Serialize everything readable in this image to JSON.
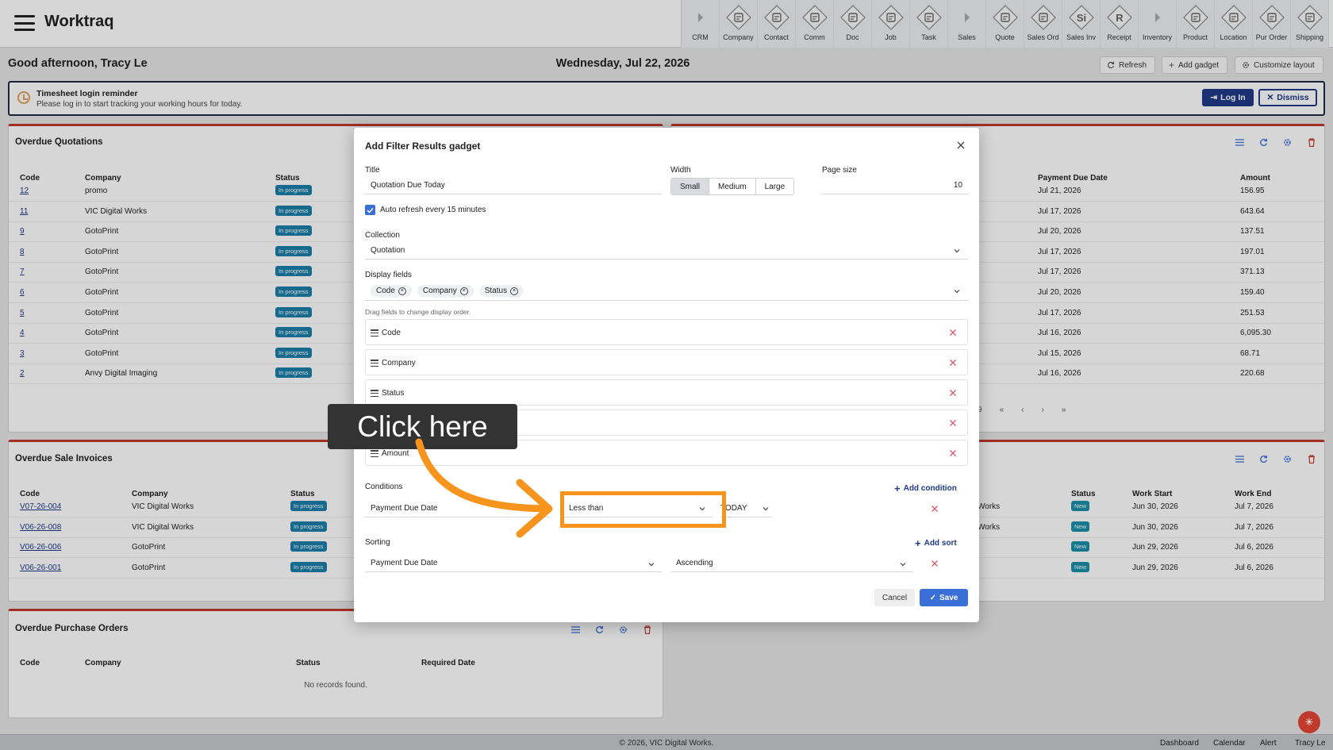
{
  "app": {
    "title": "Worktraq"
  },
  "modules": [
    {
      "label": "CRM",
      "icon": "chevron-right-icon",
      "sep": true
    },
    {
      "label": "Company",
      "icon": "company-icon"
    },
    {
      "label": "Contact",
      "icon": "contact-icon"
    },
    {
      "label": "Comm",
      "icon": "comm-icon"
    },
    {
      "label": "Doc",
      "icon": "doc-icon"
    },
    {
      "label": "Job",
      "icon": "job-icon"
    },
    {
      "label": "Task",
      "icon": "task-icon"
    },
    {
      "label": "Sales",
      "icon": "chevron-right-icon",
      "sep": true
    },
    {
      "label": "Quote",
      "icon": "quote-icon"
    },
    {
      "label": "Sales Ord",
      "icon": "sales-order-icon"
    },
    {
      "label": "Sales Inv",
      "icon": "sales-invoice-icon",
      "glyph": "Si"
    },
    {
      "label": "Receipt",
      "icon": "receipt-icon",
      "glyph": "R"
    },
    {
      "label": "Inventory",
      "icon": "chevron-right-icon",
      "sep": true
    },
    {
      "label": "Product",
      "icon": "product-icon"
    },
    {
      "label": "Location",
      "icon": "location-icon"
    },
    {
      "label": "Pur Order",
      "icon": "purchase-order-icon"
    },
    {
      "label": "Shipping",
      "icon": "shipping-icon"
    }
  ],
  "dashboard": {
    "greeting": "Good afternoon, Tracy Le",
    "date": "Wednesday, Jul 22, 2026",
    "refresh": "Refresh",
    "add_gadget": "Add gadget",
    "customize": "Customize layout"
  },
  "reminder": {
    "title": "Timesheet login reminder",
    "text": "Please log in to start tracking your working hours for today.",
    "login": "Log In",
    "dismiss": "Dismiss"
  },
  "quotations": {
    "title": "Overdue Quotations",
    "headers": [
      "Code",
      "Company",
      "Status"
    ],
    "rows": [
      {
        "code": "12",
        "company": "promo",
        "status": "In progress"
      },
      {
        "code": "11",
        "company": "VIC Digital Works",
        "status": "In progress"
      },
      {
        "code": "9",
        "company": "GotoPrint",
        "status": "In progress"
      },
      {
        "code": "8",
        "company": "GotoPrint",
        "status": "In progress"
      },
      {
        "code": "7",
        "company": "GotoPrint",
        "status": "In progress"
      },
      {
        "code": "6",
        "company": "GotoPrint",
        "status": "In progress"
      },
      {
        "code": "5",
        "company": "GotoPrint",
        "status": "In progress"
      },
      {
        "code": "4",
        "company": "GotoPrint",
        "status": "In progress"
      },
      {
        "code": "3",
        "company": "GotoPrint",
        "status": "In progress"
      },
      {
        "code": "2",
        "company": "Anvy Digital Imaging",
        "status": "In progress"
      }
    ]
  },
  "right_top": {
    "headers": [
      "Payment Due Date",
      "Amount"
    ],
    "rows": [
      {
        "date": "Jul 21, 2026",
        "amount": "156.95"
      },
      {
        "date": "Jul 17, 2026",
        "amount": "643.64"
      },
      {
        "date": "Jul 20, 2026",
        "amount": "137.51"
      },
      {
        "date": "Jul 17, 2026",
        "amount": "197.01"
      },
      {
        "date": "Jul 17, 2026",
        "amount": "371.13"
      },
      {
        "date": "Jul 20, 2026",
        "amount": "159.40"
      },
      {
        "date": "Jul 17, 2026",
        "amount": "251.53"
      },
      {
        "date": "Jul 16, 2026",
        "amount": "6,095.30"
      },
      {
        "date": "Jul 15, 2026",
        "amount": "68.71"
      },
      {
        "date": "Jul 16, 2026",
        "amount": "220.68"
      }
    ],
    "pager": [
      "9",
      "«",
      "‹",
      "›",
      "»"
    ]
  },
  "invoices": {
    "title": "Overdue Sale Invoices",
    "headers": [
      "Code",
      "Company",
      "Status"
    ],
    "rows": [
      {
        "code": "V07-26-004",
        "company": "VIC Digital Works",
        "status": "In progress"
      },
      {
        "code": "V06-26-008",
        "company": "VIC Digital Works",
        "status": "In progress"
      },
      {
        "code": "V06-26-006",
        "company": "GotoPrint",
        "status": "In progress"
      },
      {
        "code": "V06-26-001",
        "company": "GotoPrint",
        "status": "In progress"
      }
    ]
  },
  "right_mid": {
    "headers": [
      "Status",
      "Work Start",
      "Work End"
    ],
    "rows": [
      {
        "frag": "Works",
        "status": "New",
        "start": "Jun 30, 2026",
        "end": "Jul 7, 2026"
      },
      {
        "frag": "Works",
        "status": "New",
        "start": "Jun 30, 2026",
        "end": "Jul 7, 2026"
      },
      {
        "frag": "",
        "status": "New",
        "start": "Jun 29, 2026",
        "end": "Jul 6, 2026"
      },
      {
        "frag": "",
        "status": "New",
        "start": "Jun 29, 2026",
        "end": "Jul 6, 2026"
      }
    ]
  },
  "purchase": {
    "title": "Overdue Purchase Orders",
    "headers": [
      "Code",
      "Company",
      "Status",
      "Required Date"
    ],
    "empty": "No records found."
  },
  "modal": {
    "title": "Add Filter Results gadget",
    "title_label": "Title",
    "title_value": "Quotation Due Today",
    "width_label": "Width",
    "widths": [
      "Small",
      "Medium",
      "Large"
    ],
    "width_selected": "Small",
    "page_size_label": "Page size",
    "page_size": "10",
    "auto_refresh": "Auto refresh every 15 minutes",
    "collection_label": "Collection",
    "collection": "Quotation",
    "display_label": "Display fields",
    "chips": [
      "Code",
      "Company",
      "Status"
    ],
    "hint": "Drag fields to change display order.",
    "fields": [
      "Code",
      "Company",
      "Status",
      "",
      "Amount"
    ],
    "conditions_label": "Conditions",
    "add_condition": "Add condition",
    "cond_field": "Payment Due Date",
    "cond_op": "Less than",
    "cond_value": "TODAY",
    "sorting_label": "Sorting",
    "add_sort": "Add sort",
    "sort_field": "Payment Due Date",
    "sort_dir": "Ascending",
    "cancel": "Cancel",
    "save": "Save"
  },
  "tooltip": {
    "text": "Click here"
  },
  "footer": {
    "copyright": "© 2026, VIC Digital Works.",
    "links": [
      "Dashboard",
      "Calendar",
      "Alert",
      "Tracy Le"
    ]
  },
  "colors": {
    "accent": "#3a6fd8",
    "danger": "#c0392b",
    "highlight": "#f7941d",
    "badge": "#1a7fa8",
    "navy": "#1f2a44"
  }
}
